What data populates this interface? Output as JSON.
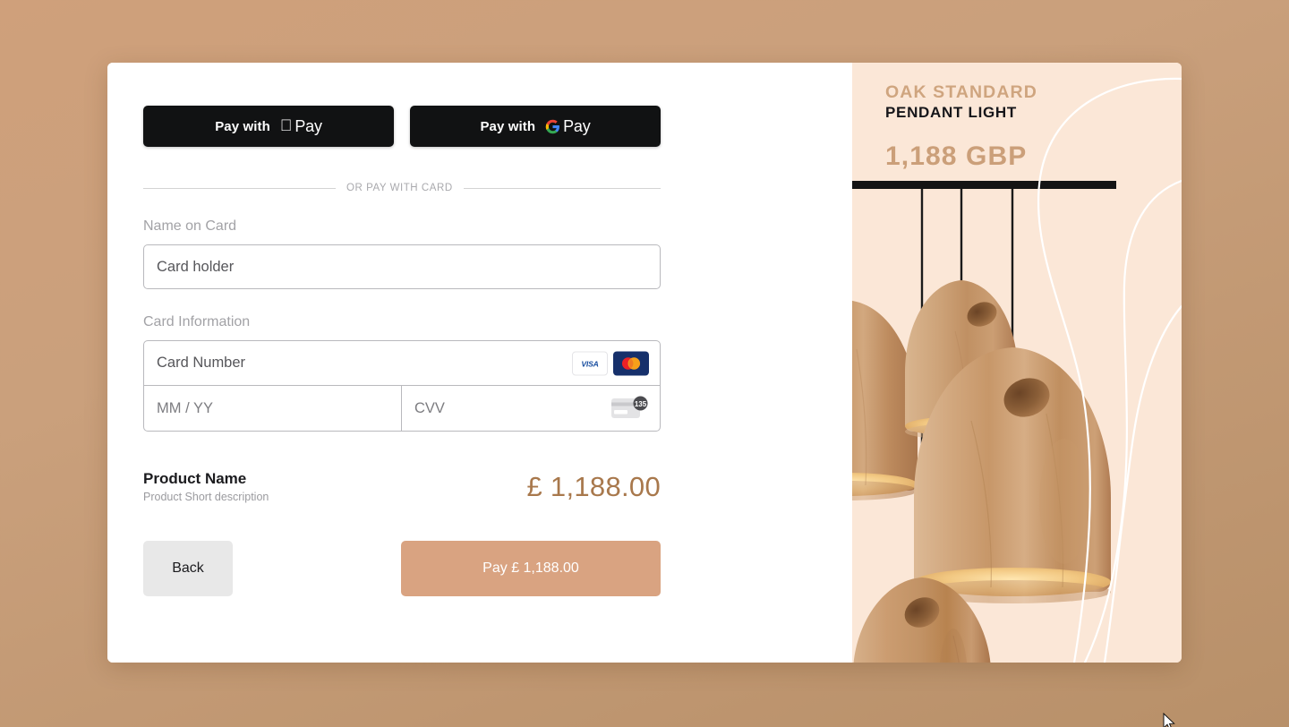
{
  "page": {
    "background_color": "#cfa07b",
    "card_background": "#ffffff"
  },
  "wallet": {
    "apple": {
      "label": "Pay with",
      "brand": "Pay",
      "icon": "apple-logo-icon",
      "background": "#111213"
    },
    "google": {
      "label": "Pay with",
      "brand": "Pay",
      "icon": "google-g-icon",
      "background": "#111213"
    }
  },
  "divider": {
    "text": "OR PAY WITH CARD"
  },
  "form": {
    "name_label": "Name on Card",
    "name_placeholder": "Card holder",
    "card_info_label": "Card Information",
    "card_number_placeholder": "Card Number",
    "expiry_placeholder": "MM / YY",
    "cvv_placeholder": "CVV",
    "visa_label": "VISA",
    "cvv_badge": "135"
  },
  "summary": {
    "product_name": "Product Name",
    "product_description": "Product Short description",
    "price": "£ 1,188.00",
    "price_color": "#a8784c"
  },
  "actions": {
    "back_label": "Back",
    "pay_label": "Pay £ 1,188.00",
    "pay_color": "#d9a381",
    "back_color": "#e8e8e8"
  },
  "showcase": {
    "title": "OAK STANDARD",
    "subtitle": "PENDANT LIGHT",
    "price": "1,188 GBP",
    "background": "#fbe7d7",
    "title_color": "#cfa57f",
    "price_color": "#cb9f79"
  }
}
